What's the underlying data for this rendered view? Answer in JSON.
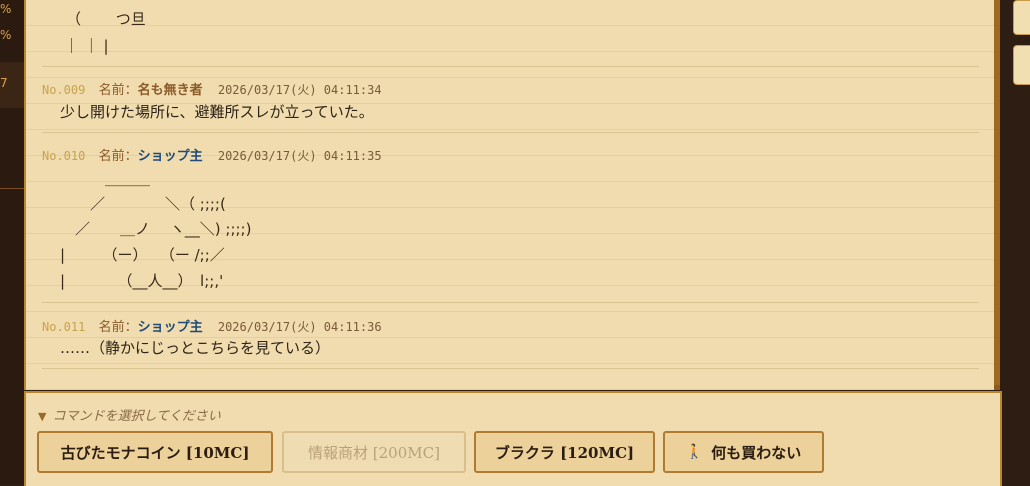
{
  "left_strip": {
    "pct1": "%",
    "pct2": "%",
    "marker": "7"
  },
  "thread": {
    "aa_top": [
      "（　　 つ旦",
      "｜ ｜ |"
    ],
    "posts": [
      {
        "no": "No.009",
        "name_label": "名前：",
        "name": "名も無き者",
        "name_color": "#8a5a2a",
        "date": "2026/03/17(火) 04:11:34",
        "body": [
          "少し開けた場所に、避難所スレが立っていた。"
        ]
      },
      {
        "no": "No.010",
        "name_label": "名前：",
        "name": "ショップ主",
        "name_color": "#1f4a78",
        "date": "2026/03/17(火) 04:11:35",
        "body": [
          "　　　＿＿＿",
          "　　／　　　　＼（ ;;;;(",
          "　／　　＿ノ　 ヽ__＼) ;;;;)",
          "|　　　（ー）　 （ー /;;／",
          "|　　　　（__人__）　l;;,'"
        ]
      },
      {
        "no": "No.011",
        "name_label": "名前：",
        "name": "ショップ主",
        "name_color": "#1f4a78",
        "date": "2026/03/17(火) 04:11:36",
        "body": [
          "……（静かにじっとこちらを見ている）"
        ]
      }
    ]
  },
  "command": {
    "prompt": "コマンドを選択してください",
    "buttons": [
      {
        "label": "古びたモナコイン [10MC]",
        "enabled": true
      },
      {
        "label": "情報商材 [200MC]",
        "enabled": false
      },
      {
        "label": "ブラクラ [120MC]",
        "enabled": true
      },
      {
        "label": "何も買わない",
        "enabled": true,
        "icon": "walking-person-icon"
      }
    ]
  }
}
